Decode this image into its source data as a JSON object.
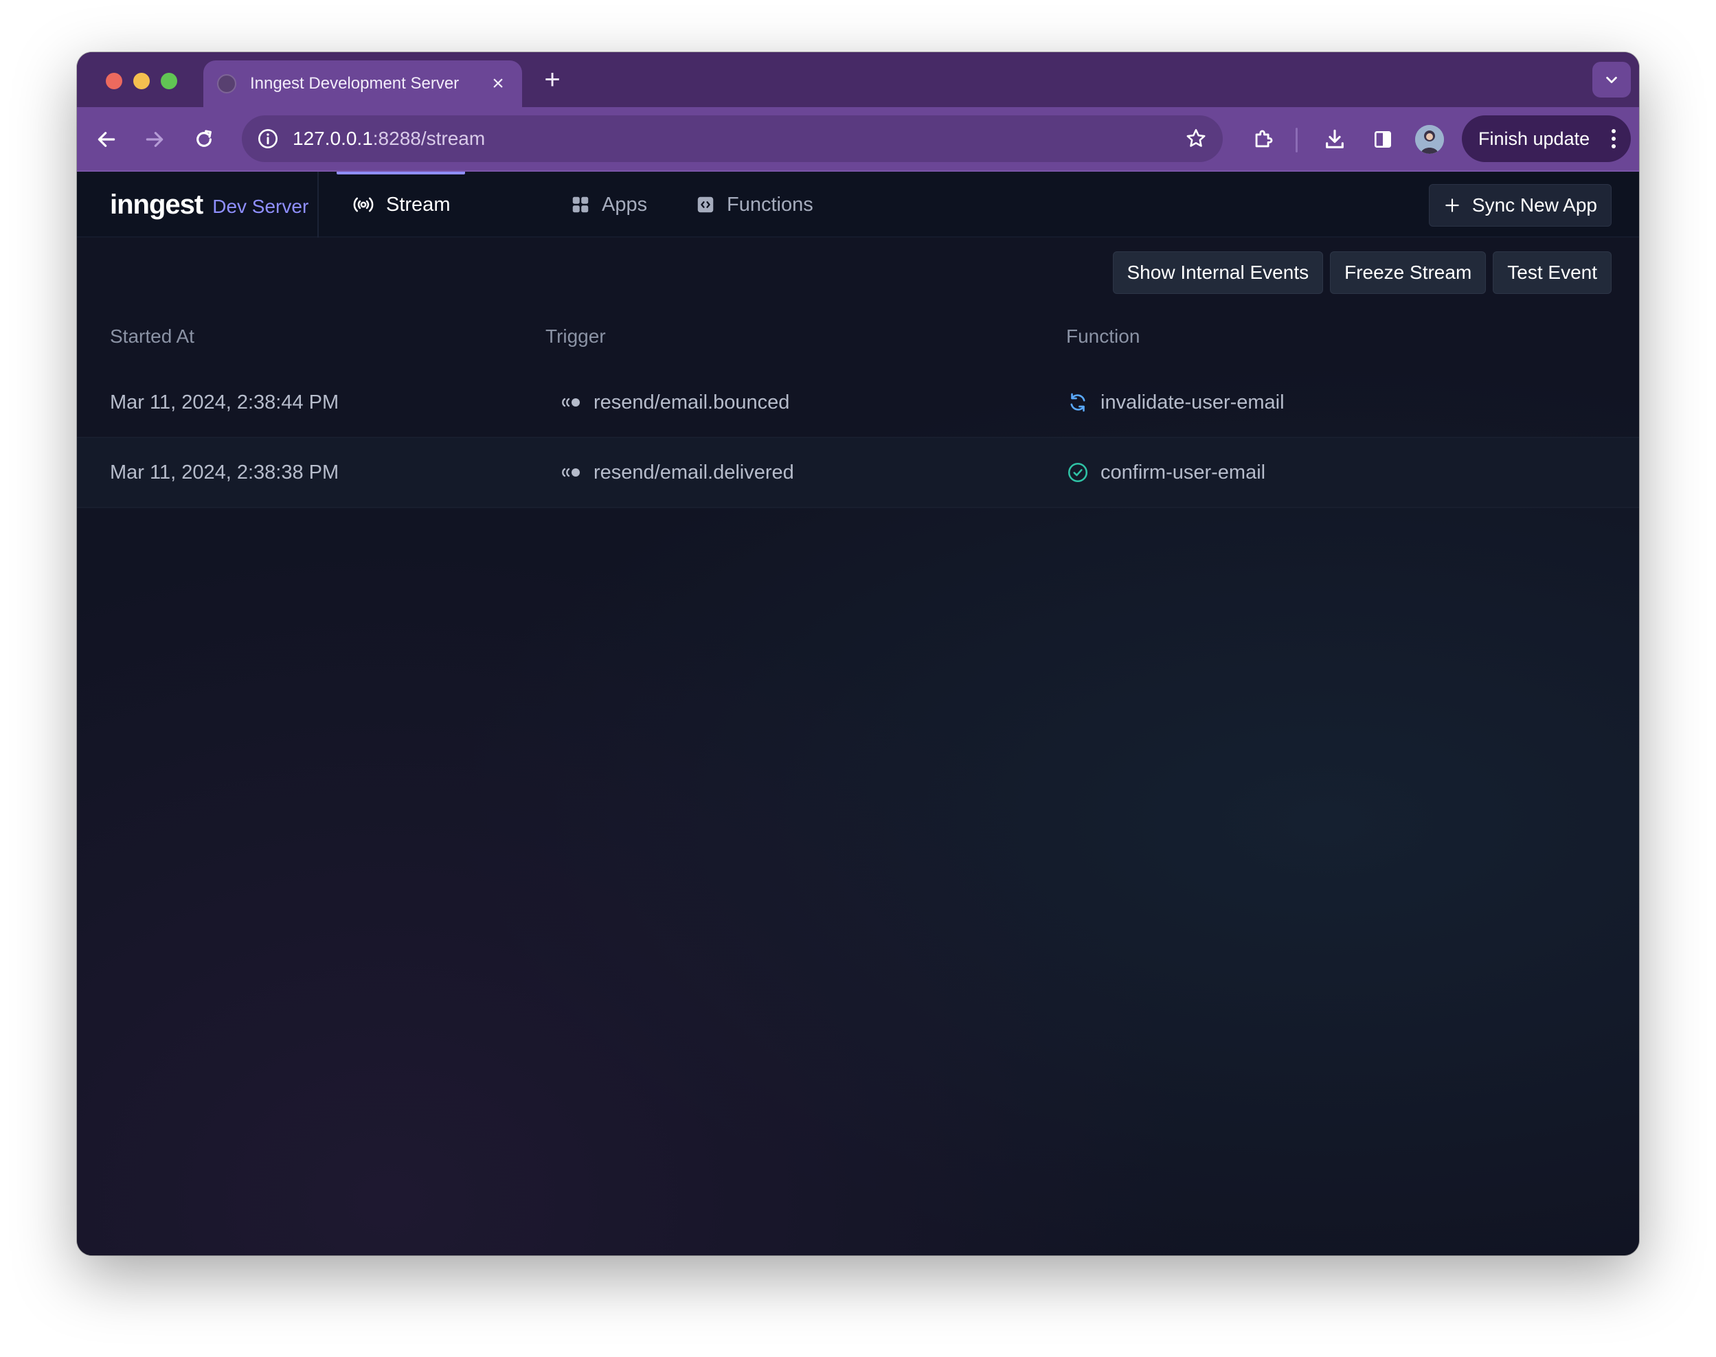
{
  "browser": {
    "tab_title": "Inngest Development Server",
    "tab_close": "×",
    "new_tab": "+",
    "url_host": "127.0.0.1",
    "url_path": ":8288/stream",
    "finish_update": "Finish update"
  },
  "header": {
    "brand_name": "inngest",
    "brand_sub": "Dev Server",
    "tabs": [
      {
        "label": "Stream",
        "icon": "broadcast-icon",
        "active": true
      },
      {
        "label": "Apps",
        "icon": "grid-icon",
        "active": false
      },
      {
        "label": "Functions",
        "icon": "code-icon",
        "active": false
      }
    ],
    "sync_button": "Sync New App"
  },
  "actions": {
    "show_internal": "Show Internal Events",
    "freeze": "Freeze Stream",
    "test_event": "Test Event"
  },
  "table": {
    "columns": [
      "Started At",
      "Trigger",
      "Function"
    ],
    "rows": [
      {
        "started": "Mar 11, 2024, 2:38:44 PM",
        "trigger": "resend/email.bounced",
        "function": "invalidate-user-email",
        "status": "running"
      },
      {
        "started": "Mar 11, 2024, 2:38:38 PM",
        "trigger": "resend/email.delivered",
        "function": "confirm-user-email",
        "status": "completed"
      }
    ]
  },
  "colors": {
    "accent": "#8f8fff",
    "running": "#5aa9ff",
    "completed": "#2fc2a5"
  }
}
